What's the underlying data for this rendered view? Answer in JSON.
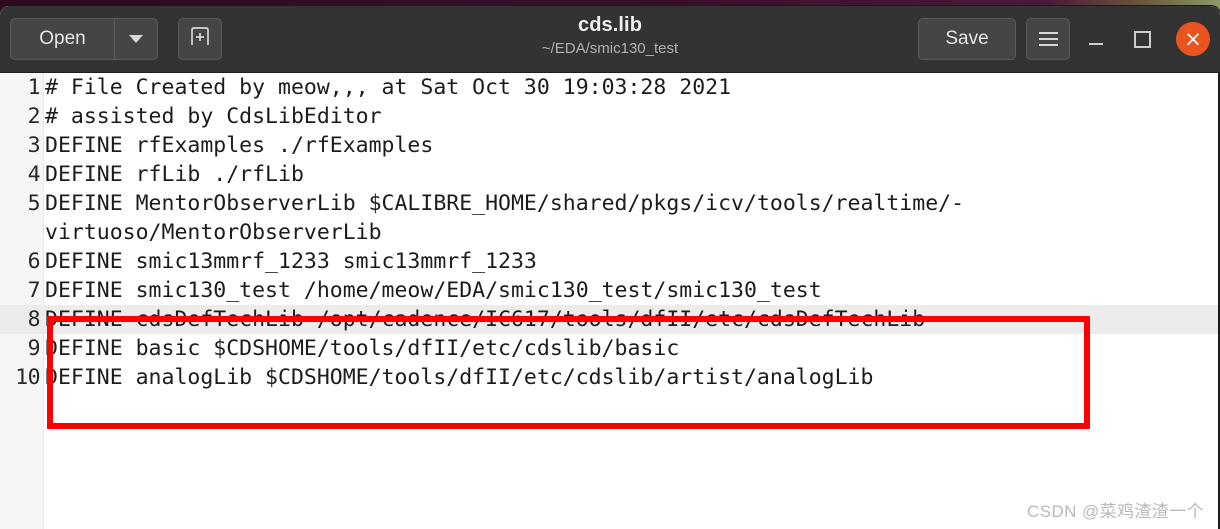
{
  "window": {
    "title": "cds.lib",
    "subtitle": "~/EDA/smic130_test"
  },
  "headerbar": {
    "open_label": "Open",
    "open_dropdown_icon": "chevron-down-icon",
    "new_tab_icon": "new-document-icon",
    "save_label": "Save",
    "menu_icon": "hamburger-menu-icon",
    "minimize_icon": "minimize-icon",
    "maximize_icon": "maximize-icon",
    "close_icon": "close-icon",
    "close_glyph": "×",
    "accent_close_color": "#e9541f",
    "bar_color": "#343333"
  },
  "editor": {
    "current_line": 8,
    "highlight_color": "#ececec",
    "lines": [
      {
        "number": "1",
        "text": "# File Created by meow,,, at Sat Oct 30 19:03:28 2021",
        "continuation": ""
      },
      {
        "number": "2",
        "text": "# assisted by CdsLibEditor",
        "continuation": ""
      },
      {
        "number": "3",
        "text": "DEFINE rfExamples ./rfExamples",
        "continuation": ""
      },
      {
        "number": "4",
        "text": "DEFINE rfLib ./rfLib",
        "continuation": ""
      },
      {
        "number": "5",
        "text": "DEFINE MentorObserverLib $CALIBRE_HOME/shared/pkgs/icv/tools/realtime/-",
        "continuation": "virtuoso/MentorObserverLib"
      },
      {
        "number": "6",
        "text": "DEFINE smic13mmrf_1233 smic13mmrf_1233",
        "continuation": ""
      },
      {
        "number": "7",
        "text": "DEFINE smic130_test /home/meow/EDA/smic130_test/smic130_test",
        "continuation": ""
      },
      {
        "number": "8",
        "text": "DEFINE cdsDefTechLib /opt/cadence/IC617/tools/dfII/etc/cdsDefTechLib",
        "continuation": ""
      },
      {
        "number": "9",
        "text": "DEFINE basic $CDSHOME/tools/dfII/etc/cdslib/basic",
        "continuation": ""
      },
      {
        "number": "10",
        "text": "DEFINE analogLib $CDSHOME/tools/dfII/etc/cdslib/artist/analogLib",
        "continuation": ""
      }
    ]
  },
  "annotation": {
    "shape": "rectangle",
    "color": "#ff0000",
    "covers_lines": "8-10"
  },
  "watermark": {
    "text": "CSDN @菜鸡渣渣一个"
  }
}
